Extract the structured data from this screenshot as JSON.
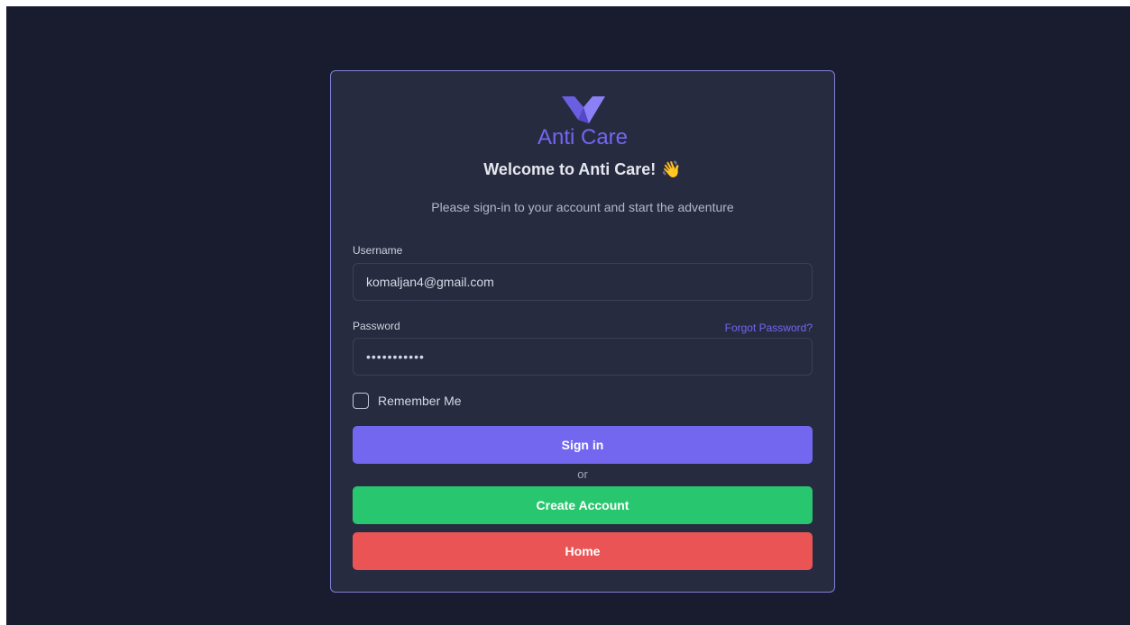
{
  "brand": {
    "name": "Anti Care",
    "accent_color": "#7367f0",
    "logo_icon": "v-check-logo-icon"
  },
  "welcome": {
    "title": "Welcome to Anti Care!",
    "emoji": "👋",
    "subtitle": "Please sign-in to your account and start the adventure"
  },
  "form": {
    "username_label": "Username",
    "username_value": "komaljan4@gmail.com",
    "password_label": "Password",
    "password_value": "•••••••••••",
    "forgot_link": "Forgot Password?",
    "remember_label": "Remember Me",
    "remember_checked": false
  },
  "buttons": {
    "signin": "Sign in",
    "or": "or",
    "create": "Create Account",
    "home": "Home"
  },
  "colors": {
    "background": "#181c2e",
    "card": "#262b40",
    "signin": "#7367f0",
    "create": "#28c76f",
    "home": "#ea5455"
  }
}
